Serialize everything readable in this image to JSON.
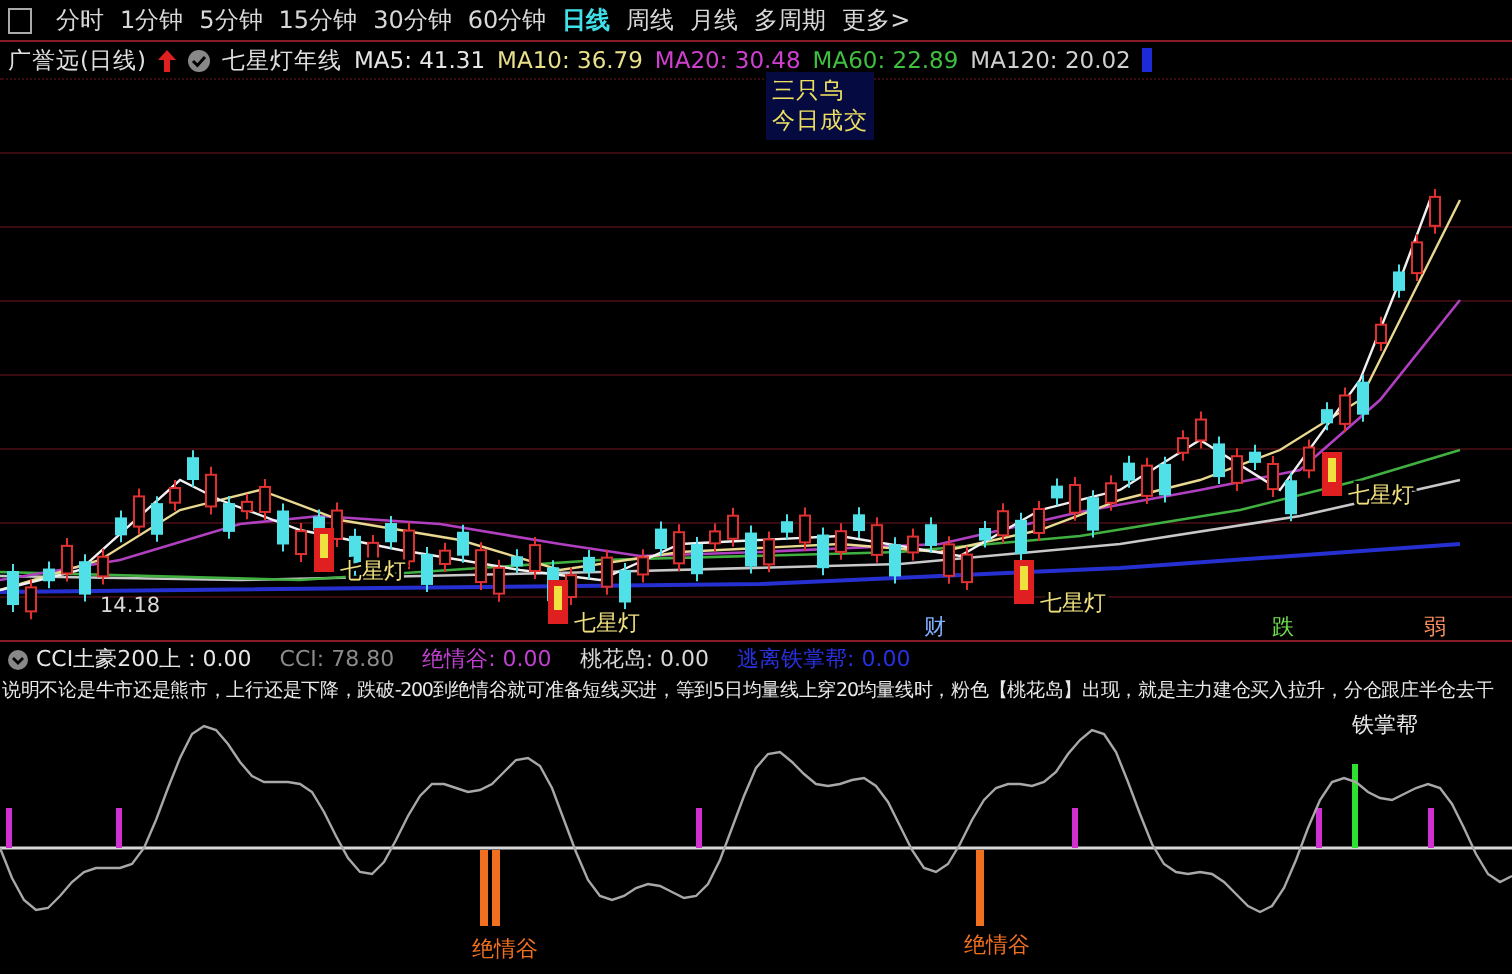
{
  "period_tabs": [
    {
      "label": "分时",
      "selected": false
    },
    {
      "label": "1分钟",
      "selected": false
    },
    {
      "label": "5分钟",
      "selected": false
    },
    {
      "label": "15分钟",
      "selected": false
    },
    {
      "label": "30分钟",
      "selected": false
    },
    {
      "label": "60分钟",
      "selected": false
    },
    {
      "label": "日线",
      "selected": true
    },
    {
      "label": "周线",
      "selected": false
    },
    {
      "label": "月线",
      "selected": false
    },
    {
      "label": "多周期",
      "selected": false
    },
    {
      "label": "更多>",
      "selected": false
    }
  ],
  "quote_line": {
    "stock": "广誉远(日线)",
    "indicator": "七星灯年线",
    "ma": [
      {
        "label": "MA5: 41.31",
        "color": "#e6e6e6"
      },
      {
        "label": "MA10: 36.79",
        "color": "#e8e08a"
      },
      {
        "label": "MA20: 30.48",
        "color": "#d040d0"
      },
      {
        "label": "MA60: 22.89",
        "color": "#40c040"
      },
      {
        "label": "MA120: 20.02",
        "color": "#d0d0d0"
      }
    ]
  },
  "main_chart": {
    "notes": [
      "三只乌",
      "今日成交"
    ],
    "markers": [
      "七星灯",
      "七星灯",
      "七星灯",
      "七星灯"
    ],
    "low_price": "14.18",
    "signals": [
      {
        "label": "财",
        "color": "#80b0ff"
      },
      {
        "label": "跌",
        "color": "#70e050"
      },
      {
        "label": "弱",
        "color": "#ff9060"
      }
    ]
  },
  "indicator_header": [
    {
      "label": "CCI土豪200上 : 0.00",
      "color": "#e6e6e6"
    },
    {
      "label": "CCI: 78.80",
      "color": "#8a8a8a"
    },
    {
      "label": "绝情谷: 0.00",
      "color": "#c040d0"
    },
    {
      "label": "桃花岛: 0.00",
      "color": "#d8d8d8"
    },
    {
      "label": "逃离铁掌帮: 0.00",
      "color": "#2830e0"
    }
  ],
  "description": "说明不论是牛市还是熊市，上行还是下降，跌破-200到绝情谷就可准备短线买进，等到5日均量线上穿20均量线时，粉色【桃花岛】出现，就是主力建仓买入拉升，分仓跟庄半仓去干",
  "oscillator": {
    "labels": [
      "铁掌帮",
      "绝情谷",
      "绝情谷"
    ]
  }
}
